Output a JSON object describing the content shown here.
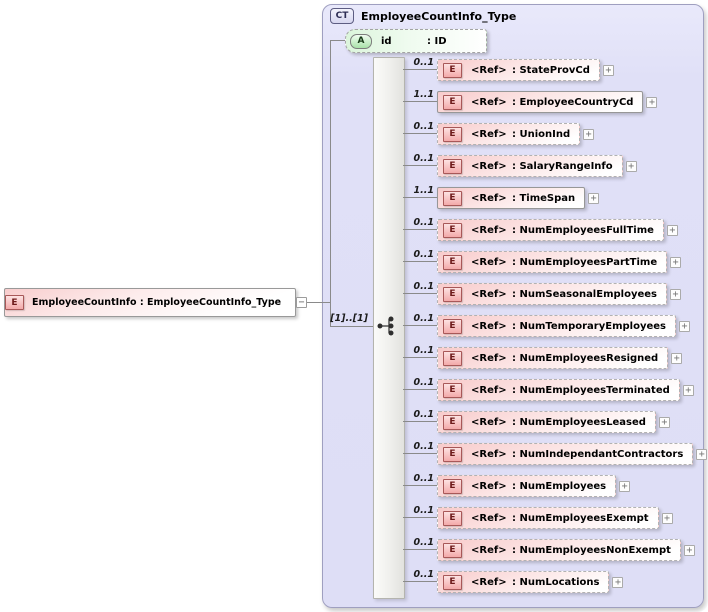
{
  "root_element": {
    "badge": "E",
    "label": "EmployeeCountInfo : EmployeeCountInfo_Type",
    "collapse_glyph": "−"
  },
  "complex_type": {
    "badge": "CT",
    "title": "EmployeeCountInfo_Type",
    "attribute": {
      "badge": "A",
      "name": "id",
      "type": ": ID"
    },
    "expand_glyph": "+",
    "sequence": {
      "cardinality": "[1]..[1]",
      "icon": "sequence-icon",
      "children": [
        {
          "cardinality": "0..1",
          "badge": "E",
          "ref": "<Ref>",
          "type": ": StateProvCd",
          "optional": true
        },
        {
          "cardinality": "1..1",
          "badge": "E",
          "ref": "<Ref>",
          "type": ": EmployeeCountryCd",
          "optional": false
        },
        {
          "cardinality": "0..1",
          "badge": "E",
          "ref": "<Ref>",
          "type": ": UnionInd",
          "optional": true
        },
        {
          "cardinality": "0..1",
          "badge": "E",
          "ref": "<Ref>",
          "type": ": SalaryRangeInfo",
          "optional": true
        },
        {
          "cardinality": "1..1",
          "badge": "E",
          "ref": "<Ref>",
          "type": ": TimeSpan",
          "optional": false
        },
        {
          "cardinality": "0..1",
          "badge": "E",
          "ref": "<Ref>",
          "type": ": NumEmployeesFullTime",
          "optional": true
        },
        {
          "cardinality": "0..1",
          "badge": "E",
          "ref": "<Ref>",
          "type": ": NumEmployeesPartTime",
          "optional": true
        },
        {
          "cardinality": "0..1",
          "badge": "E",
          "ref": "<Ref>",
          "type": ": NumSeasonalEmployees",
          "optional": true
        },
        {
          "cardinality": "0..1",
          "badge": "E",
          "ref": "<Ref>",
          "type": ": NumTemporaryEmployees",
          "optional": true
        },
        {
          "cardinality": "0..1",
          "badge": "E",
          "ref": "<Ref>",
          "type": ": NumEmployeesResigned",
          "optional": true
        },
        {
          "cardinality": "0..1",
          "badge": "E",
          "ref": "<Ref>",
          "type": ": NumEmployeesTerminated",
          "optional": true
        },
        {
          "cardinality": "0..1",
          "badge": "E",
          "ref": "<Ref>",
          "type": ": NumEmployeesLeased",
          "optional": true
        },
        {
          "cardinality": "0..1",
          "badge": "E",
          "ref": "<Ref>",
          "type": ": NumIndependantContractors",
          "optional": true
        },
        {
          "cardinality": "0..1",
          "badge": "E",
          "ref": "<Ref>",
          "type": ": NumEmployees",
          "optional": true
        },
        {
          "cardinality": "0..1",
          "badge": "E",
          "ref": "<Ref>",
          "type": ": NumEmployeesExempt",
          "optional": true
        },
        {
          "cardinality": "0..1",
          "badge": "E",
          "ref": "<Ref>",
          "type": ": NumEmployeesNonExempt",
          "optional": true
        },
        {
          "cardinality": "0..1",
          "badge": "E",
          "ref": "<Ref>",
          "type": ": NumLocations",
          "optional": true
        }
      ]
    }
  },
  "colors": {
    "element_fill": "#f8cbcb",
    "element_badge_border": "#a85858",
    "attribute_fill": "#dcf5dc",
    "complex_type_fill": "#dedef6"
  }
}
